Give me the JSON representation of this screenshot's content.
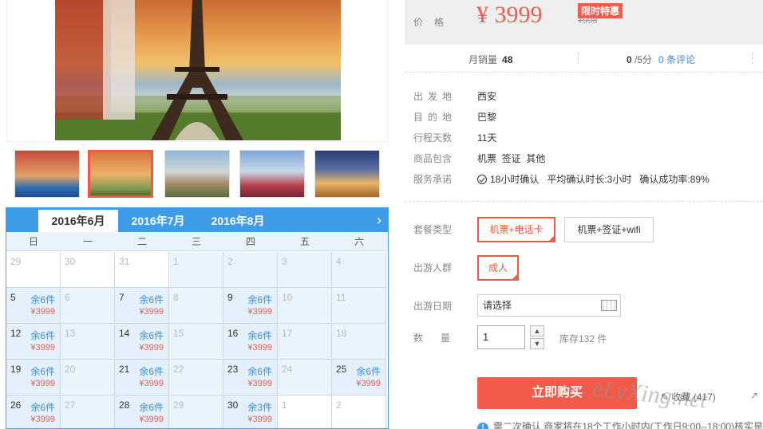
{
  "price": {
    "label": "价格",
    "amount": "¥ 3999",
    "promo_badge": "限时特惠",
    "original": "¥998"
  },
  "stats": {
    "monthly_sales_label": "月销量",
    "monthly_sales": "48",
    "rating": "0",
    "rating_suffix": "/5分",
    "reviews": "0 条评论"
  },
  "info": [
    {
      "key": "出发地",
      "value": "西安"
    },
    {
      "key": "目的地",
      "value": "巴黎"
    },
    {
      "key": "行程天数",
      "value": "11天"
    },
    {
      "key": "商品包含",
      "value": "机票  签证  其他"
    },
    {
      "key": "服务承诺",
      "value": "18小时确认   平均确认时长:3小时   确认成功率:89%"
    }
  ],
  "options": {
    "package_label": "套餐类型",
    "packages": [
      "机票+电话卡",
      "机票+签证+wifi"
    ],
    "group_label": "出游人群",
    "groups": [
      "成人"
    ],
    "date_label": "出游日期",
    "date_placeholder": "请选择",
    "qty_label": "数量",
    "qty_value": "1",
    "stock": "库存132 件"
  },
  "actions": {
    "buy": "立即购买",
    "favorite": "收藏 (417)",
    "notice": "需二次确认  商家将在18个工作小时内(工作日9:00--18:00)核实是否有位"
  },
  "watermark": "eLvXing.net",
  "calendar": {
    "months": [
      "2016年6月",
      "2016年7月",
      "2016年8月"
    ],
    "active_month": 0,
    "weekdays": [
      "日",
      "一",
      "二",
      "三",
      "四",
      "五",
      "六"
    ],
    "weeks": [
      [
        {
          "d": "29",
          "t": "blank"
        },
        {
          "d": "30",
          "t": "blank"
        },
        {
          "d": "31",
          "t": "blank"
        },
        {
          "d": "1",
          "t": "off"
        },
        {
          "d": "2",
          "t": "off"
        },
        {
          "d": "3",
          "t": "off"
        },
        {
          "d": "4",
          "t": "off"
        }
      ],
      [
        {
          "d": "5",
          "t": "avail",
          "s": "余6件",
          "p": "¥3999"
        },
        {
          "d": "6",
          "t": "off"
        },
        {
          "d": "7",
          "t": "avail",
          "s": "余6件",
          "p": "¥3999"
        },
        {
          "d": "8",
          "t": "off"
        },
        {
          "d": "9",
          "t": "avail",
          "s": "余6件",
          "p": "¥3999"
        },
        {
          "d": "10",
          "t": "off"
        },
        {
          "d": "11",
          "t": "off"
        }
      ],
      [
        {
          "d": "12",
          "t": "avail",
          "s": "余6件",
          "p": "¥3999"
        },
        {
          "d": "13",
          "t": "off"
        },
        {
          "d": "14",
          "t": "avail",
          "s": "余6件",
          "p": "¥3999"
        },
        {
          "d": "15",
          "t": "off"
        },
        {
          "d": "16",
          "t": "avail",
          "s": "余6件",
          "p": "¥3999"
        },
        {
          "d": "17",
          "t": "off"
        },
        {
          "d": "18",
          "t": "off"
        }
      ],
      [
        {
          "d": "19",
          "t": "avail",
          "s": "余6件",
          "p": "¥3999"
        },
        {
          "d": "20",
          "t": "off"
        },
        {
          "d": "21",
          "t": "avail",
          "s": "余6件",
          "p": "¥3999"
        },
        {
          "d": "22",
          "t": "off"
        },
        {
          "d": "23",
          "t": "avail",
          "s": "余6件",
          "p": "¥3999"
        },
        {
          "d": "24",
          "t": "off"
        },
        {
          "d": "25",
          "t": "avail",
          "s": "余6件",
          "p": "¥3999"
        }
      ],
      [
        {
          "d": "26",
          "t": "avail",
          "s": "余6件",
          "p": "¥3999"
        },
        {
          "d": "27",
          "t": "off"
        },
        {
          "d": "28",
          "t": "avail",
          "s": "余6件",
          "p": "¥3999"
        },
        {
          "d": "29",
          "t": "off"
        },
        {
          "d": "30",
          "t": "avail",
          "s": "余3件",
          "p": "¥3999"
        },
        {
          "d": "1",
          "t": "blank"
        },
        {
          "d": "2",
          "t": "blank"
        }
      ]
    ]
  },
  "thumbs": [
    "eiffel-promo",
    "eiffel-sunset",
    "chateau",
    "eiffel-blossom",
    "arc-de-triomphe"
  ],
  "colors": {
    "accent": "#f25a4a",
    "calendar_blue": "#3d9be8",
    "link": "#3d8ed8"
  }
}
